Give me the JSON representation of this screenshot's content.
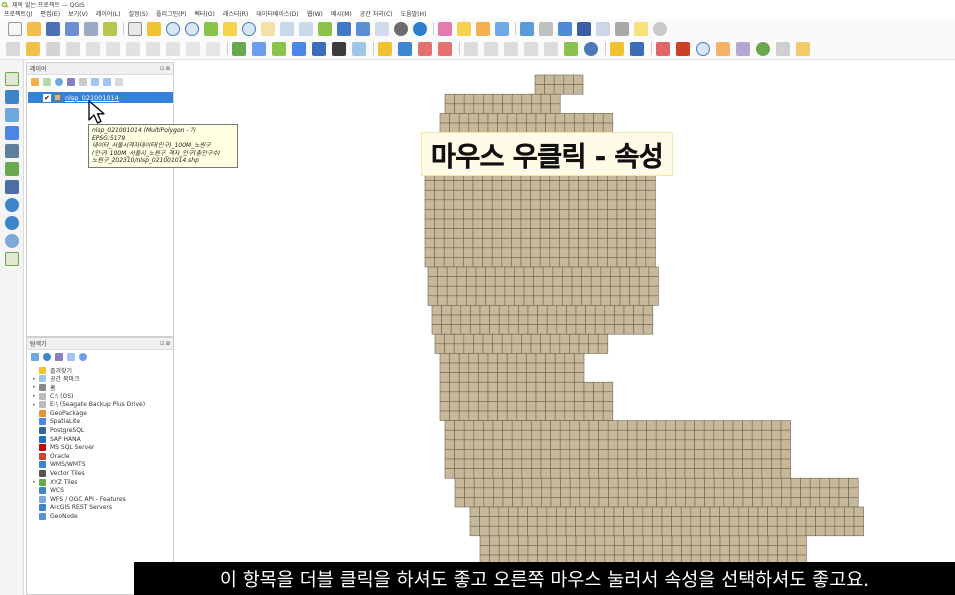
{
  "window": {
    "title": "제목 없는 프로젝트 — QGIS"
  },
  "menubar": {
    "items": [
      "프로젝트(J)",
      "편집(E)",
      "보기(V)",
      "레이어(L)",
      "설정(S)",
      "플러그인(P)",
      "벡터(O)",
      "래스터(R)",
      "데이터베이스(D)",
      "웹(W)",
      "메시(M)",
      "공간 처리(C)",
      "도움말(H)"
    ]
  },
  "layers_panel": {
    "title": "레이어",
    "controls": "⊡ ⊠",
    "layer": {
      "name": "nlsp_021001014",
      "checked": "✔",
      "swatch_color": "#c8b89a"
    },
    "tooltip": {
      "header": "nlsp_021001014 (MultiPolygon - ?)",
      "lines": [
        "EPSG:5179",
        "데이터_서울시격자데이터(인구)_100M_노원구",
        "(인구) 100M_서울시_노원구_격자_인구(총인구수)",
        "노원구_202310/nlsp_021001014.shp"
      ]
    }
  },
  "browser_panel": {
    "title": "탐색기",
    "controls": "⊡ ⊠",
    "items": [
      {
        "label": "즐겨찾기",
        "icon": "star-icon",
        "expander": ""
      },
      {
        "label": "공간 북마크",
        "icon": "bookmark-icon",
        "expander": "▸"
      },
      {
        "label": "홈",
        "icon": "home-icon",
        "expander": "▸"
      },
      {
        "label": "C:\\ (OS)",
        "icon": "drive-icon",
        "expander": "▸"
      },
      {
        "label": "E:\\ (Seagate Backup Plus Drive)",
        "icon": "drive-icon",
        "expander": "▸"
      },
      {
        "label": "GeoPackage",
        "icon": "geopackage-icon",
        "expander": ""
      },
      {
        "label": "SpatiaLite",
        "icon": "spatialite-icon",
        "expander": ""
      },
      {
        "label": "PostgreSQL",
        "icon": "postgresql-icon",
        "expander": ""
      },
      {
        "label": "SAP HANA",
        "icon": "saphana-icon",
        "expander": ""
      },
      {
        "label": "MS SQL Server",
        "icon": "mssql-icon",
        "expander": ""
      },
      {
        "label": "Oracle",
        "icon": "oracle-icon",
        "expander": ""
      },
      {
        "label": "WMS/WMTS",
        "icon": "wms-icon",
        "expander": ""
      },
      {
        "label": "Vector Tiles",
        "icon": "vector-tiles-icon",
        "expander": ""
      },
      {
        "label": "XYZ Tiles",
        "icon": "xyz-tiles-icon",
        "expander": "▸"
      },
      {
        "label": "WCS",
        "icon": "wcs-icon",
        "expander": ""
      },
      {
        "label": "WFS / OGC API - Features",
        "icon": "wfs-icon",
        "expander": ""
      },
      {
        "label": "ArcGIS REST Servers",
        "icon": "arcgis-icon",
        "expander": ""
      },
      {
        "label": "GeoNode",
        "icon": "geonode-icon",
        "expander": ""
      }
    ]
  },
  "map": {
    "fill_color": "#c8b89a",
    "stroke_color": "#6e6555"
  },
  "overlay": {
    "title": "마우스 우클릭 - 속성"
  },
  "subtitle": {
    "text": "이 항목을 더블 클릭을 하셔도 좋고 오른쪽 마우스 눌러서 속성을 선택하셔도 좋고요."
  }
}
